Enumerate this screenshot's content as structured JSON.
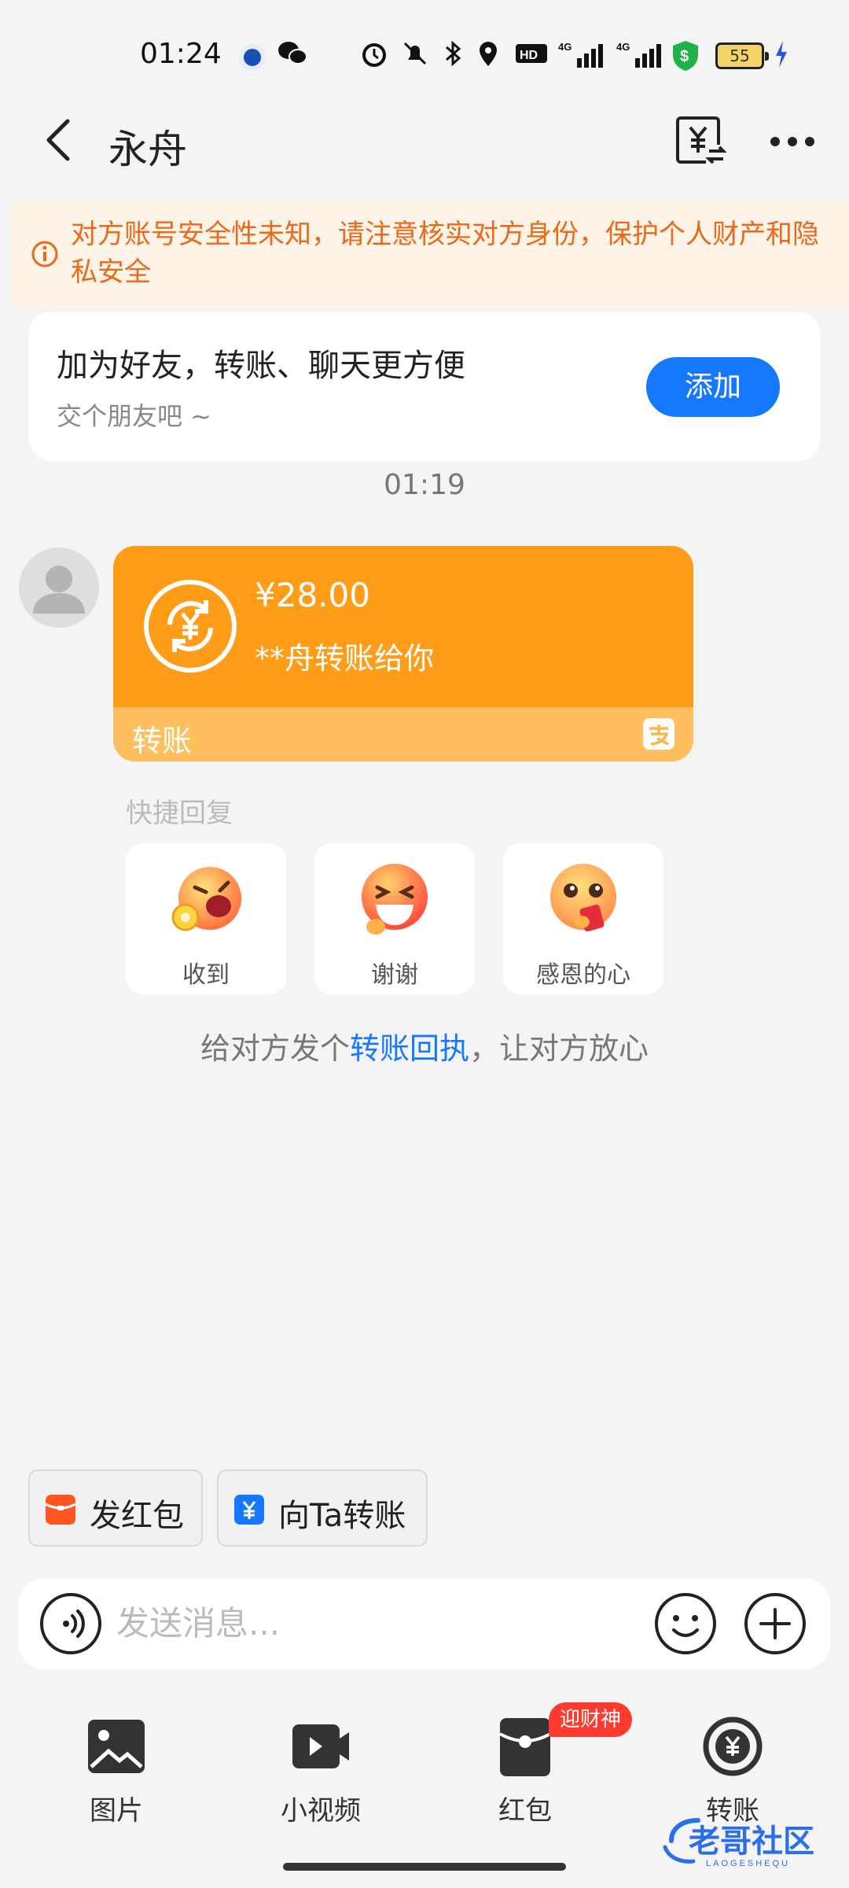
{
  "status_bar": {
    "time": "01:24",
    "battery": "55"
  },
  "nav": {
    "title": "永舟"
  },
  "warning": {
    "text": "对方账号安全性未知，请注意核实对方身份，保护个人财产和隐私安全"
  },
  "friend_card": {
    "title": "加为好友，转账、聊天更方便",
    "subtitle": "交个朋友吧 ~",
    "button": "添加"
  },
  "chat": {
    "timestamp": "01:19",
    "transfer": {
      "amount": "¥28.00",
      "desc": "**舟转账给你",
      "label": "转账"
    }
  },
  "quick_reply": {
    "title": "快捷回复",
    "items": [
      {
        "label": "收到"
      },
      {
        "label": "谢谢"
      },
      {
        "label": "感恩的心"
      }
    ]
  },
  "receipt_tip": {
    "prefix": "给对方发个",
    "link": "转账回执",
    "suffix": "，让对方放心"
  },
  "shortcuts": {
    "red_packet": "发红包",
    "transfer_to": "向Ta转账"
  },
  "input": {
    "placeholder": "发送消息..."
  },
  "tools": {
    "items": [
      {
        "label": "图片"
      },
      {
        "label": "小视频"
      },
      {
        "label": "红包"
      },
      {
        "label": "转账"
      }
    ],
    "badge": "迎财神"
  },
  "watermark": {
    "text": "老哥社区",
    "subtext": "LAOGESHEQU"
  },
  "colors": {
    "accent": "#1677ff",
    "orange": "#ff9d19",
    "warning": "#e86a1a"
  }
}
